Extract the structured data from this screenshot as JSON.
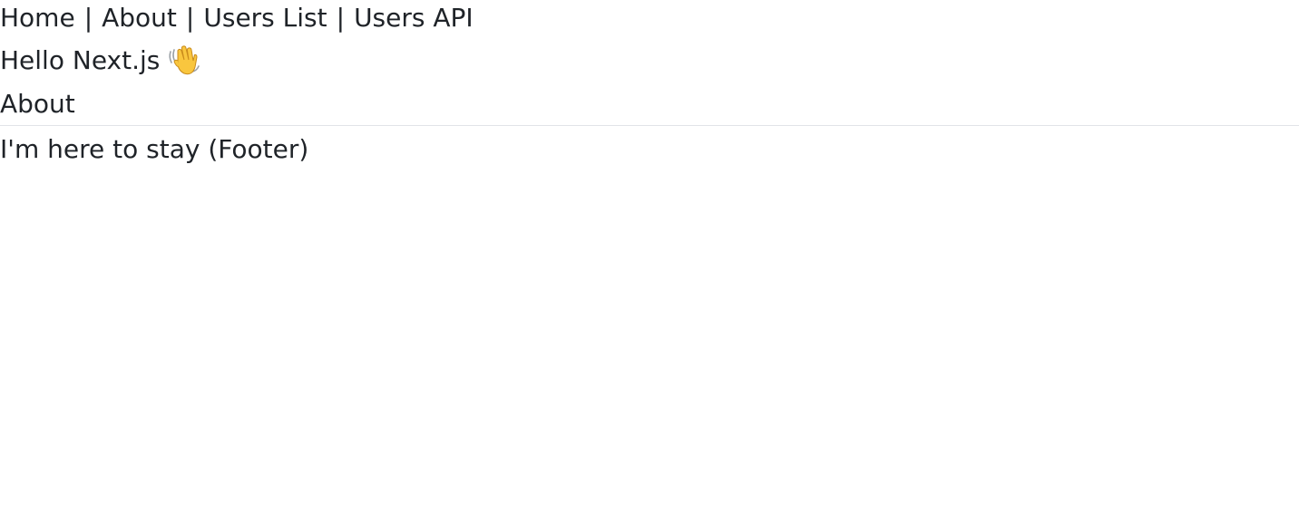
{
  "nav": {
    "items": [
      {
        "label": "Home"
      },
      {
        "label": "About"
      },
      {
        "label": "Users List"
      },
      {
        "label": "Users API"
      }
    ],
    "separator": "|"
  },
  "greeting": {
    "text": "Hello Next.js",
    "icon": "waving-hand-icon"
  },
  "page": {
    "heading": "About"
  },
  "footer": {
    "text": "I'm here to stay (Footer)"
  },
  "colors": {
    "text": "#1f2328",
    "divider": "#e1e4e8",
    "background": "#ffffff"
  }
}
